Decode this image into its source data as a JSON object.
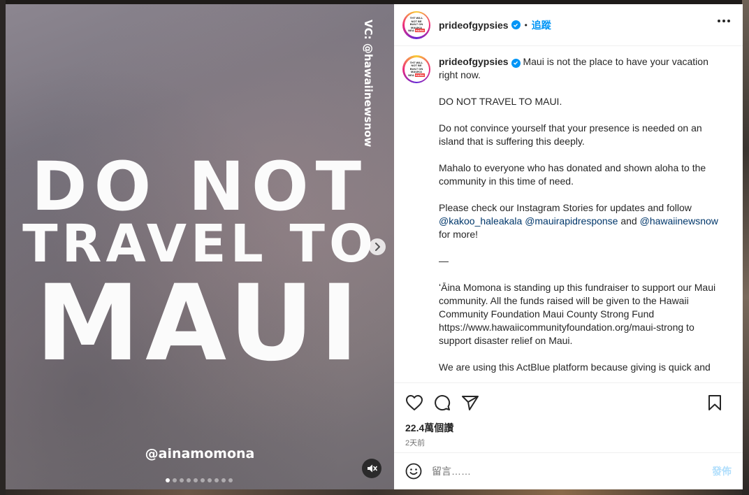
{
  "media": {
    "headline_line1": "DO NOT",
    "headline_line2": "TRAVEL TO",
    "headline_line3": "MAUI",
    "video_credit": "VC: @hawaiinewsnow",
    "handle": "@ainamomona",
    "carousel": {
      "total": 10,
      "active_index": 0
    },
    "next_icon": "chevron-right-icon",
    "mute_icon": "speaker-muted-icon"
  },
  "header": {
    "username": "prideofgypsies",
    "verified": true,
    "separator": "•",
    "follow_label": "追蹤",
    "avatar_text": [
      "THT WILL",
      "NOT BE",
      "BUILT ON",
      "MAUIKA",
      "NEA",
      "HARM"
    ]
  },
  "caption": {
    "username": "prideofgypsies",
    "first_line": "Maui is not the place to have your vacation right now.",
    "p2": "DO NOT TRAVEL TO MAUI.",
    "p3": "Do not convince yourself that your presence is needed on an island that is suffering this deeply.",
    "p4": "Mahalo to everyone who has donated and shown aloha to the community in this time of need.",
    "p5_start": "Please check our Instagram Stories for updates and follow ",
    "mention1": "@kakoo_haleakala",
    "mention2": "@mauirapidresponse",
    "p5_and": " and ",
    "mention3": "@hawaiinewsnow",
    "p5_end": " for more!",
    "p6": "—",
    "p7": "ʻĀina Momona is standing up this fundraiser to support our Maui community. All the funds raised will be given to the Hawaii Community Foundation Maui County Strong Fund https://www.hawaiicommunityfoundation.org/maui-strong to support disaster relief on Maui.",
    "p8": "We are using this ActBlue platform because giving is quick and"
  },
  "actions": {
    "views": "22.4萬個讚",
    "date": "2天前",
    "icons": [
      "heart-icon",
      "comment-icon",
      "share-icon",
      "bookmark-icon"
    ]
  },
  "comment": {
    "placeholder": "留言……",
    "post_label": "發佈",
    "emoji_icon": "emoji-icon"
  },
  "colors": {
    "accent": "#0095f6",
    "mention": "#00376b",
    "post_disabled": "#b2dffc"
  }
}
